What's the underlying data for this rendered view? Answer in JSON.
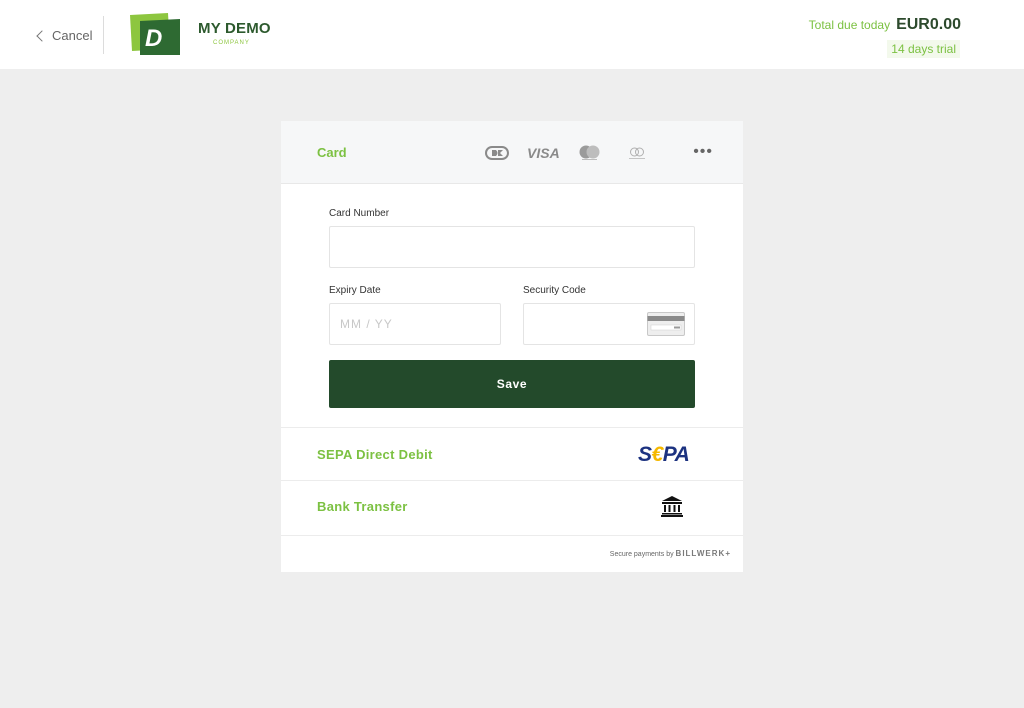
{
  "header": {
    "cancel_label": "Cancel",
    "brand_name": "MY DEMO",
    "brand_sub": "COMPANY",
    "logo_letter": "D",
    "total_label": "Total due today",
    "total_value": "EUR0.00",
    "trial_label": "14 days trial"
  },
  "card": {
    "title": "Card",
    "payment_icons": [
      "dankort-icon",
      "visa-icon",
      "mastercard-icon",
      "maestro-icon"
    ],
    "visa_text": "VISA",
    "more_label": "•••",
    "card_number_label": "Card Number",
    "card_number_value": "",
    "expiry_label": "Expiry Date",
    "expiry_placeholder": "MM / YY",
    "security_label": "Security Code",
    "security_value": "",
    "save_label": "Save"
  },
  "methods": {
    "sepa_label": "SEPA Direct Debit",
    "sepa_logo": {
      "s": "S",
      "euro": "€",
      "pa": "PA"
    },
    "bank_label": "Bank Transfer"
  },
  "footer": {
    "secure_prefix": "Secure payments by",
    "secure_brand": "BILLWERK+"
  },
  "colors": {
    "accent_green": "#7cc142",
    "dark_green": "#234a2b",
    "background": "#eeeeee",
    "sepa_blue": "#1c3280",
    "sepa_yellow": "#f5b800"
  }
}
